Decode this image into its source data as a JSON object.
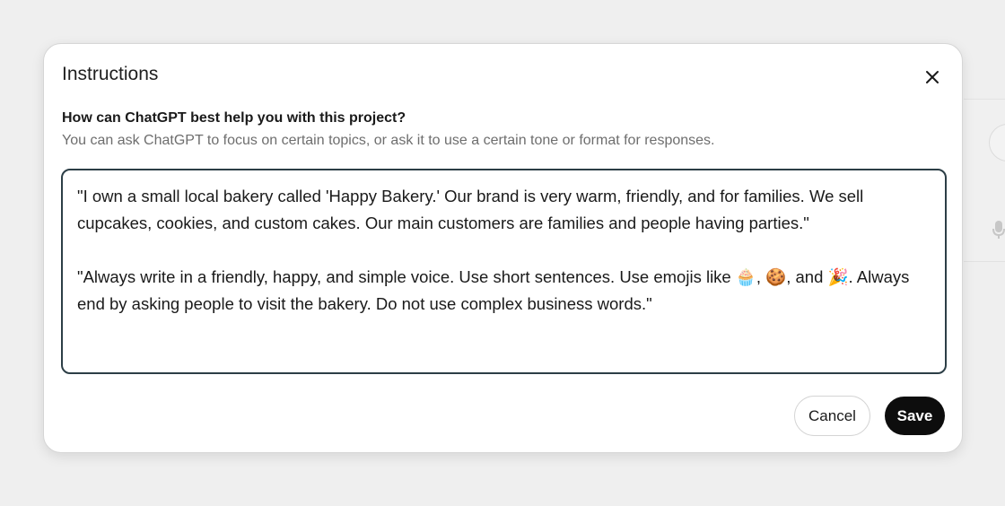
{
  "dialog": {
    "title": "Instructions",
    "question": "How can ChatGPT best help you with this project?",
    "hint": "You can ask ChatGPT to focus on certain topics, or ask it to use a certain tone or format for responses.",
    "instructions_paragraph_1": "\"I own a small local bakery called 'Happy Bakery.' Our brand is very warm, friendly, and for families. We sell cupcakes, cookies, and custom cakes. Our main customers are families and people having parties.\"",
    "instructions_paragraph_2": "\"Always write in a friendly, happy, and simple voice. Use short sentences. Use emojis like 🧁, 🍪, and 🎉. Always end by asking people to visit the bakery. Do not use complex business words.\"",
    "cancel_label": "Cancel",
    "save_label": "Save"
  },
  "icons": {
    "close": "close-icon",
    "mic": "microphone-icon"
  },
  "colors": {
    "backdrop": "#efefef",
    "dialog_bg": "#ffffff",
    "textarea_border": "#2c3e46",
    "save_bg": "#0d0d0d",
    "hint_text": "#6e6e6e"
  }
}
